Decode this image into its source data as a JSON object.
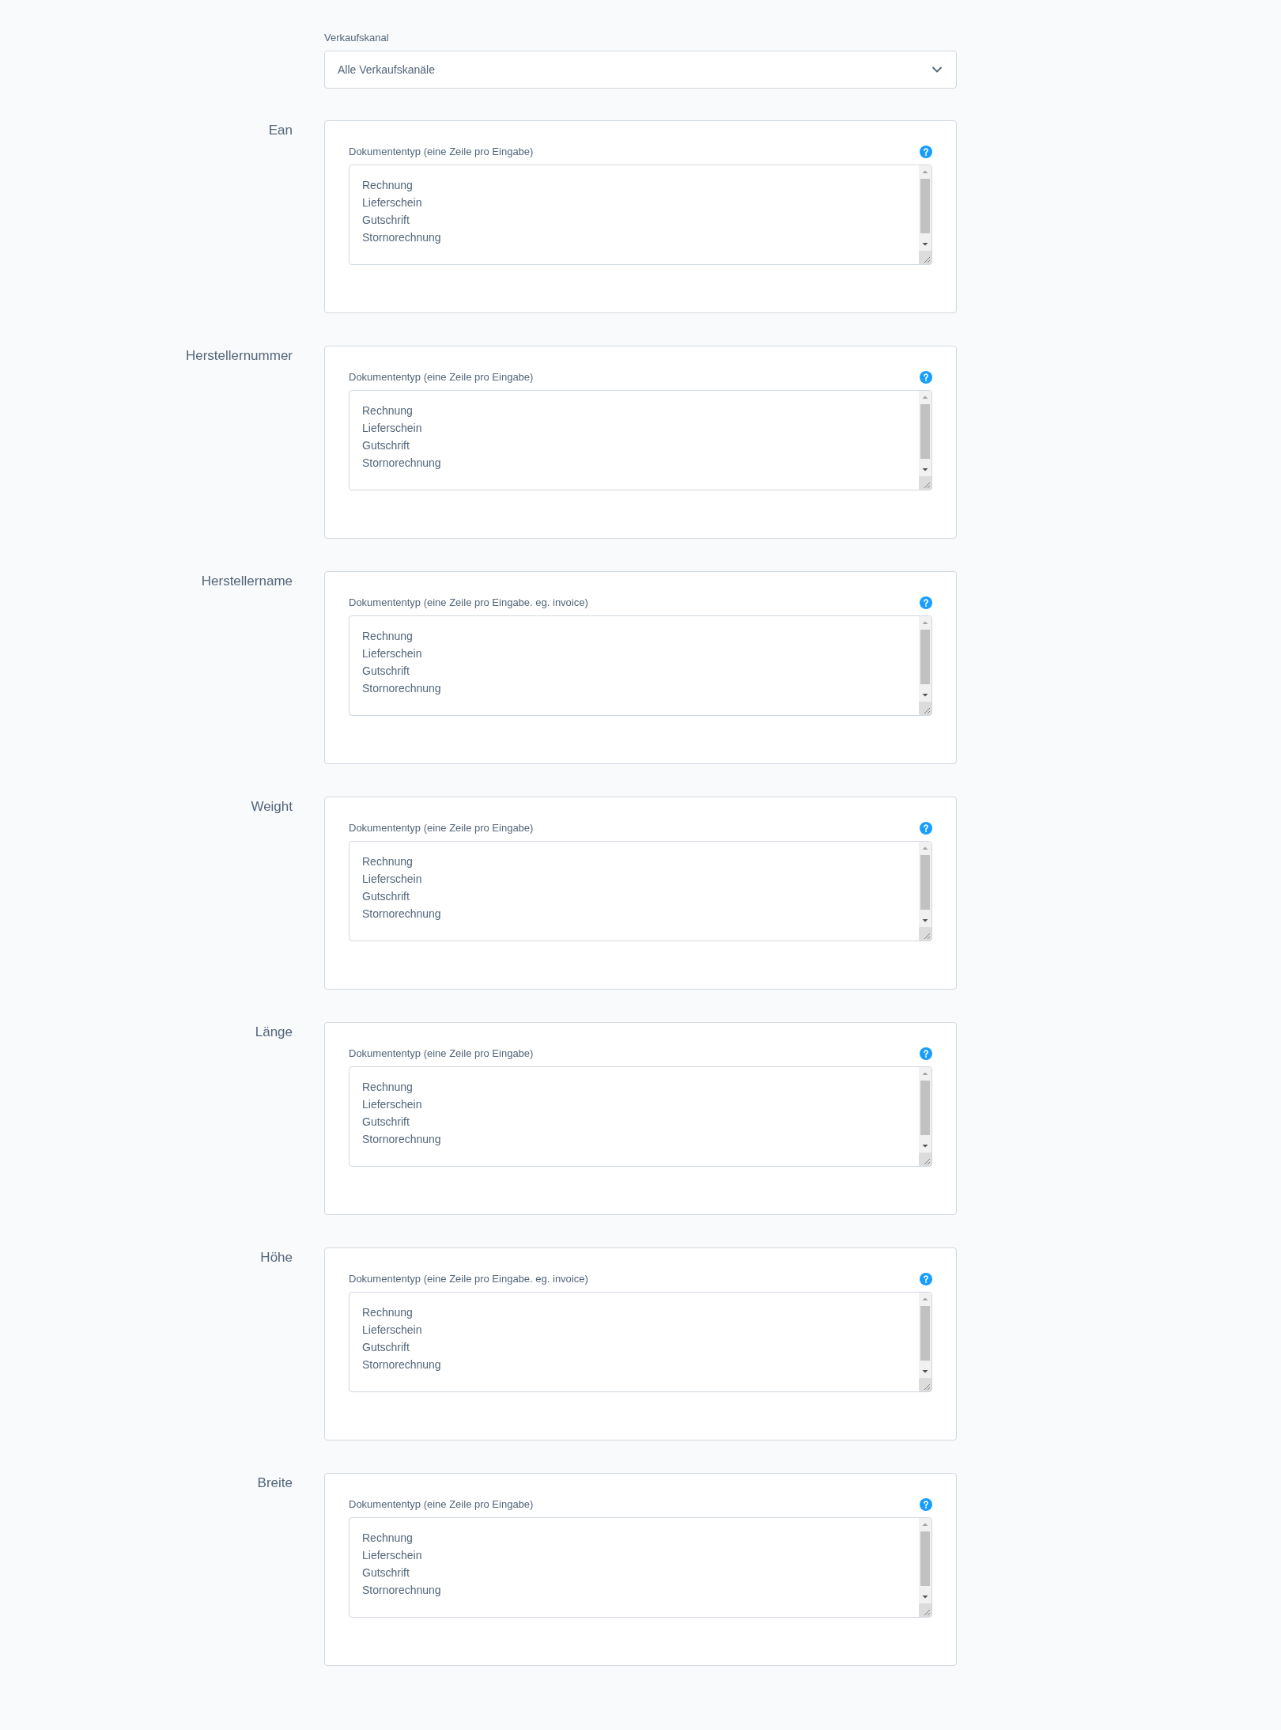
{
  "sales_channel": {
    "label": "Verkaufskanal",
    "value": "Alle Verkaufskanäle"
  },
  "fields": [
    {
      "label": "Ean",
      "input_label": "Dokumententyp (eine Zeile pro Eingabe)",
      "lines": [
        "Rechnung",
        "Lieferschein",
        "Gutschrift",
        "Stornorechnung"
      ]
    },
    {
      "label": "Herstellernummer",
      "input_label": "Dokumententyp (eine Zeile pro Eingabe)",
      "lines": [
        "Rechnung",
        "Lieferschein",
        "Gutschrift",
        "Stornorechnung"
      ]
    },
    {
      "label": "Herstellername",
      "input_label": "Dokumententyp (eine Zeile pro Eingabe. eg. invoice)",
      "lines": [
        "Rechnung",
        "Lieferschein",
        "Gutschrift",
        "Stornorechnung"
      ]
    },
    {
      "label": "Weight",
      "input_label": "Dokumententyp (eine Zeile pro Eingabe)",
      "lines": [
        "Rechnung",
        "Lieferschein",
        "Gutschrift",
        "Stornorechnung"
      ]
    },
    {
      "label": "Länge",
      "input_label": "Dokumententyp (eine Zeile pro Eingabe)",
      "lines": [
        "Rechnung",
        "Lieferschein",
        "Gutschrift",
        "Stornorechnung"
      ]
    },
    {
      "label": "Höhe",
      "input_label": "Dokumententyp (eine Zeile pro Eingabe. eg. invoice)",
      "lines": [
        "Rechnung",
        "Lieferschein",
        "Gutschrift",
        "Stornorechnung"
      ]
    },
    {
      "label": "Breite",
      "input_label": "Dokumententyp (eine Zeile pro Eingabe)",
      "lines": [
        "Rechnung",
        "Lieferschein",
        "Gutschrift",
        "Stornorechnung"
      ]
    }
  ]
}
